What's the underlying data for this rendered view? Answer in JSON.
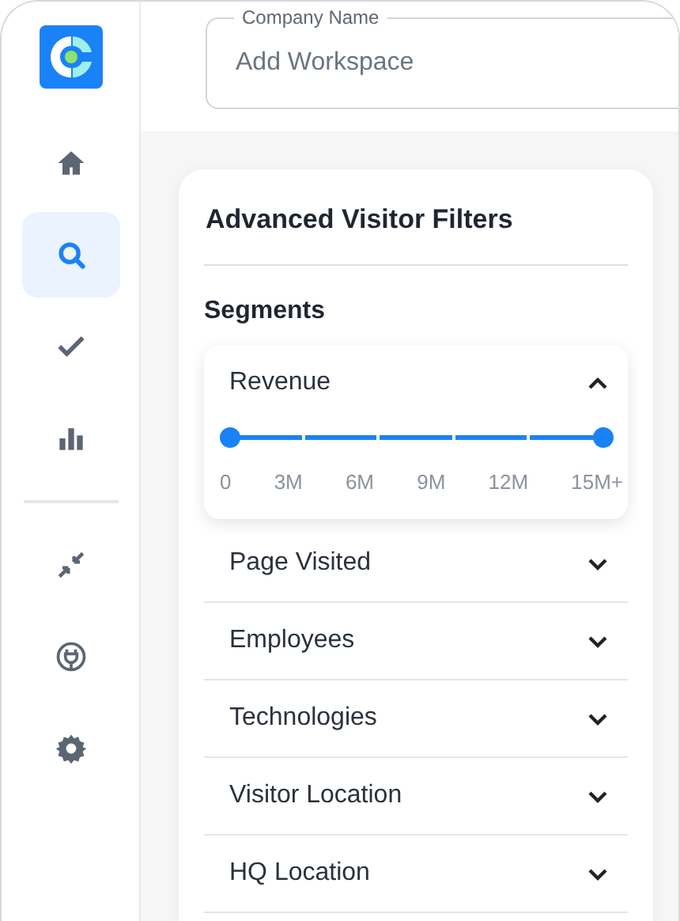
{
  "sidebar": {
    "items": [
      {
        "selected": false
      },
      {
        "selected": true
      },
      {
        "selected": false
      },
      {
        "selected": false
      },
      {
        "selected": false
      },
      {
        "selected": false
      },
      {
        "selected": false
      }
    ]
  },
  "workspace_field": {
    "label": "Company Name",
    "placeholder": "Add Workspace"
  },
  "card": {
    "title": "Advanced Visitor Filters",
    "section": "Segments",
    "filters": [
      {
        "label": "Revenue",
        "expanded": true,
        "slider": {
          "start": {
            "level": 0
          },
          "end": {
            "level": 1
          },
          "ticks": [
            "0",
            "3M",
            "6M",
            "9M",
            "12M",
            "15M+"
          ]
        }
      },
      {
        "label": "Page Visited",
        "expanded": false
      },
      {
        "label": "Employees",
        "expanded": false
      },
      {
        "label": "Technologies",
        "expanded": false
      },
      {
        "label": "Visitor Location",
        "expanded": false
      },
      {
        "label": "HQ Location",
        "expanded": false
      }
    ]
  }
}
